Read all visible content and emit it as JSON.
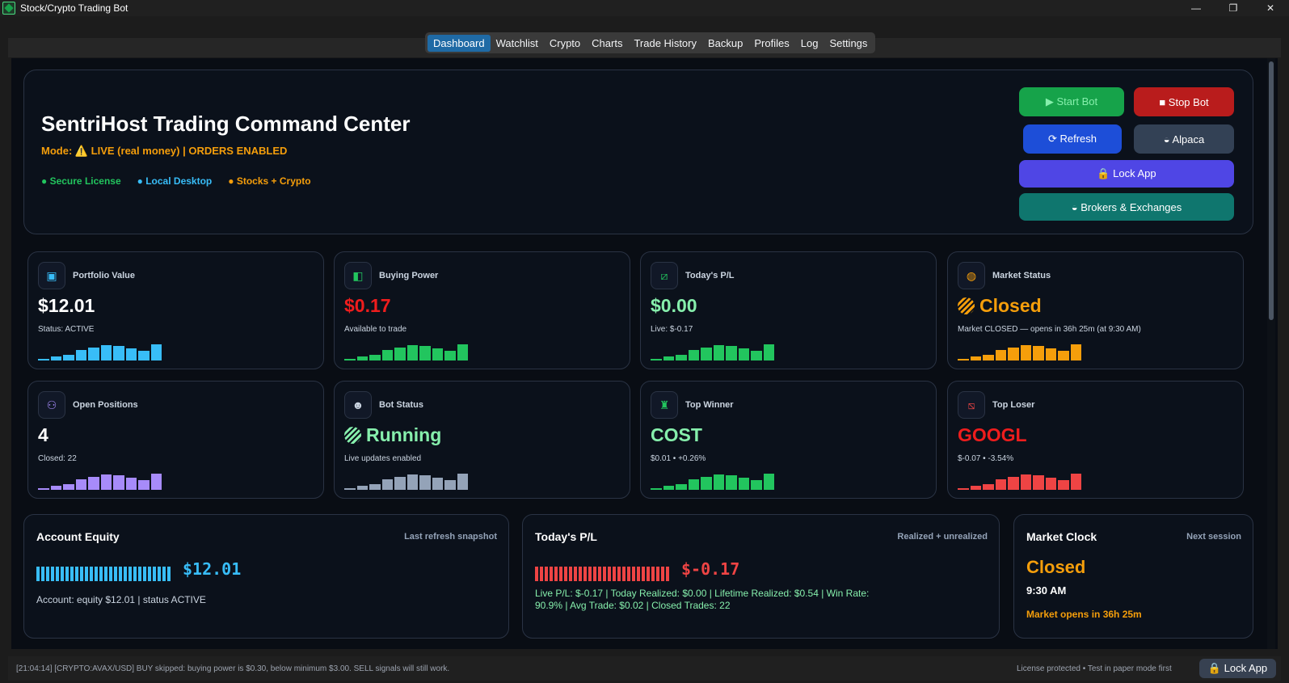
{
  "window": {
    "title": "Stock/Crypto Trading Bot",
    "controls": [
      "—",
      "❐",
      "✕"
    ]
  },
  "tabs": [
    "Dashboard",
    "Watchlist",
    "Crypto",
    "Charts",
    "Trade History",
    "Backup",
    "Profiles",
    "Log",
    "Settings"
  ],
  "active_tab": "Dashboard",
  "hero": {
    "title": "SentriHost Trading Command Center",
    "mode": "Mode: ⚠️ LIVE (real money)  |  ORDERS ENABLED",
    "tags": [
      "● Secure License",
      "● Local Desktop",
      "● Stocks + Crypto"
    ],
    "buttons": {
      "start": "▶ Start Bot",
      "stop": "■ Stop Bot",
      "refresh": "⟳ Refresh",
      "alpaca": "◒ Alpaca",
      "lock": "🔒 Lock App",
      "brokers": "◒ Brokers & Exchanges"
    }
  },
  "cards": [
    {
      "label": "Portfolio Value",
      "value": "$12.01",
      "sub": "Status: ACTIVE",
      "icon": "briefcase-icon",
      "glyph": "▣",
      "icon_color": "#38bdf8",
      "value_color": "#ffffff",
      "spark_color": "#38bdf8",
      "spark": [
        2,
        4,
        6,
        11,
        14,
        16,
        15,
        13,
        10,
        17
      ]
    },
    {
      "label": "Buying Power",
      "value": "$0.17",
      "sub": "Available to trade",
      "icon": "wallet-icon",
      "glyph": "◧",
      "icon_color": "#22c55e",
      "value_color": "#ef1d1d",
      "spark_color": "#22c55e",
      "spark": [
        2,
        4,
        6,
        11,
        14,
        16,
        15,
        13,
        10,
        17
      ]
    },
    {
      "label": "Today's P/L",
      "value": "$0.00",
      "sub": "Live: $-0.17",
      "icon": "trend-chart-icon",
      "glyph": "⧄",
      "icon_color": "#22c55e",
      "value_color": "#86efac",
      "spark_color": "#22c55e",
      "spark": [
        2,
        4,
        6,
        11,
        14,
        16,
        15,
        13,
        10,
        17
      ]
    },
    {
      "label": "Market Status",
      "value": "Closed",
      "sub": "Market CLOSED — opens in 36h 25m (at 9:30 AM)",
      "icon": "globe-icon",
      "glyph": "◍",
      "icon_color": "#f59e0b",
      "value_color": "#f59e0b",
      "spark_color": "#f59e0b",
      "spark": [
        2,
        4,
        6,
        11,
        14,
        16,
        15,
        13,
        10,
        17
      ],
      "dot_color": "#f59e0b"
    },
    {
      "label": "Open Positions",
      "value": "4",
      "sub": "Closed: 22",
      "icon": "users-icon",
      "glyph": "⚇",
      "icon_color": "#a78bfa",
      "value_color": "#ffffff",
      "spark_color": "#a78bfa",
      "spark": [
        2,
        4,
        6,
        11,
        14,
        16,
        15,
        13,
        10,
        17
      ]
    },
    {
      "label": "Bot Status",
      "value": "Running",
      "sub": "Live updates enabled",
      "icon": "robot-icon",
      "glyph": "☻",
      "icon_color": "#cbd5e1",
      "value_color": "#86efac",
      "spark_color": "#94a3b8",
      "spark": [
        2,
        4,
        6,
        11,
        14,
        16,
        15,
        13,
        10,
        17
      ],
      "dot_color": "#86efac"
    },
    {
      "label": "Top Winner",
      "value": "COST",
      "sub": "$0.01 • +0.26%",
      "icon": "trophy-icon",
      "glyph": "♜",
      "icon_color": "#22c55e",
      "value_color": "#86efac",
      "spark_color": "#22c55e",
      "spark": [
        2,
        4,
        6,
        11,
        14,
        16,
        15,
        13,
        10,
        17
      ]
    },
    {
      "label": "Top Loser",
      "value": "GOOGL",
      "sub": "$-0.07 • -3.54%",
      "icon": "trend-down-icon",
      "glyph": "⧅",
      "icon_color": "#ef4444",
      "value_color": "#ef1d1d",
      "spark_color": "#ef4444",
      "spark": [
        2,
        4,
        6,
        11,
        14,
        16,
        15,
        13,
        10,
        17
      ]
    }
  ],
  "panels": {
    "equity": {
      "title": "Account Equity",
      "hint": "Last refresh snapshot",
      "value": "$12.01",
      "text": "Account: equity $12.01 | status ACTIVE",
      "color": "#38bdf8"
    },
    "pl": {
      "title": "Today's P/L",
      "hint": "Realized + unrealized",
      "value": "$-0.17",
      "text": "Live P/L: $-0.17 | Today Realized: $0.00 | Lifetime Realized: $0.54 | Win Rate: 90.9% | Avg Trade: $0.02 | Closed Trades: 22",
      "color": "#ef4444"
    },
    "clock": {
      "title": "Market Clock",
      "hint": "Next session",
      "value": "Closed",
      "time": "9:30 AM",
      "text": "Market opens in 36h 25m"
    }
  },
  "statusbar": {
    "message": "[21:04:14] [CRYPTO:AVAX/USD] BUY skipped: buying power is $0.30, below minimum $3.00. SELL signals will still work.",
    "right": "License protected • Test in paper mode first",
    "lock_button": "🔒 Lock App"
  }
}
